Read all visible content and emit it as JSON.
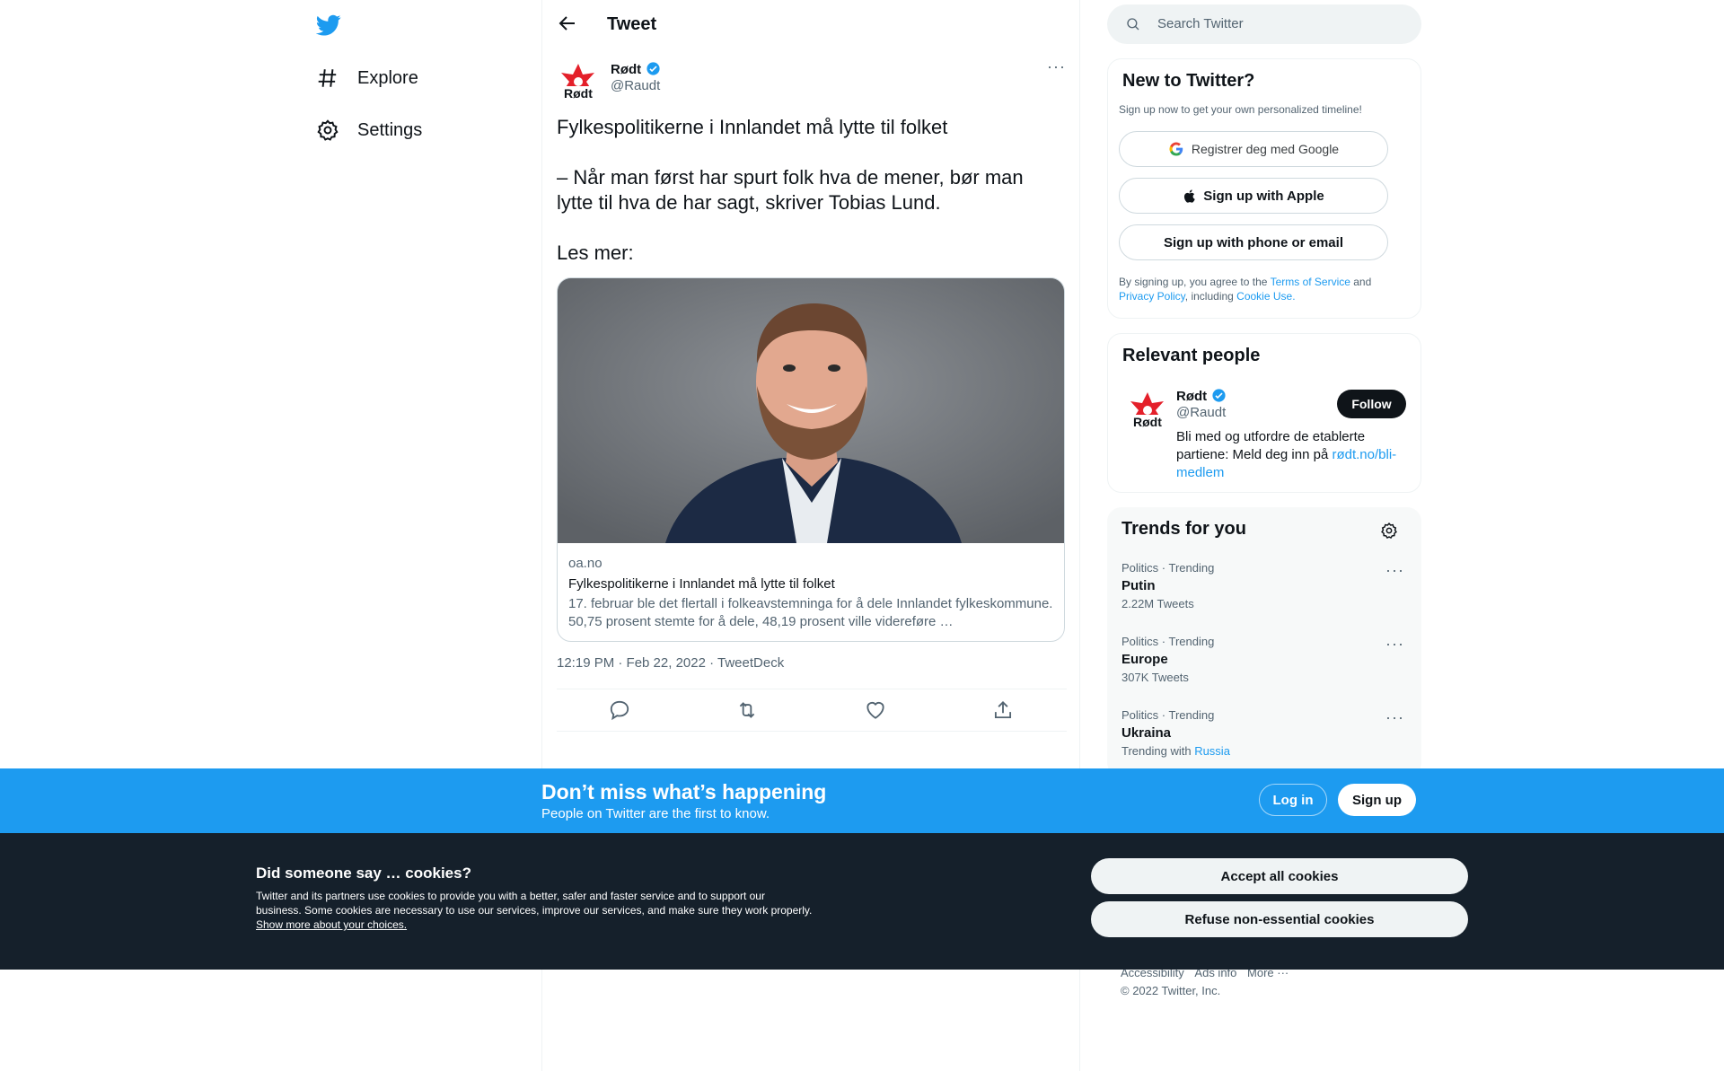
{
  "nav": {
    "explore_label": "Explore",
    "settings_label": "Settings"
  },
  "header": {
    "title": "Tweet"
  },
  "tweet": {
    "author_name": "Rødt",
    "author_handle": "@Raudt",
    "avatar_text": "Rødt",
    "text_line1": "Fylkespolitikerne i Innlandet må lytte til folket",
    "text_line2": "– Når man først har spurt folk hva de mener, bør man lytte til hva de har sagt, skriver Tobias Lund.",
    "text_line3": "Les mer:",
    "card": {
      "domain": "oa.no",
      "title": "Fylkespolitikerne i Innlandet må lytte til folket",
      "description": "17. februar ble det flertall i folkeavstemninga for å dele Innlandet fylkeskommune. 50,75 prosent stemte for å dele, 48,19 prosent ville videreføre …"
    },
    "timestamp": "12:19 PM · Feb 22, 2022 · TweetDeck"
  },
  "search": {
    "placeholder": "Search Twitter"
  },
  "signup_panel": {
    "title": "New to Twitter?",
    "subtitle": "Sign up now to get your own personalized timeline!",
    "google_label": "Registrer deg med Google",
    "apple_label": "Sign up with Apple",
    "phone_label": "Sign up with phone or email",
    "legal_prefix": "By signing up, you agree to the ",
    "terms_link": "Terms of Service",
    "legal_and": " and",
    "privacy_link": "Privacy Policy",
    "legal_including": ", including ",
    "cookie_link": "Cookie Use."
  },
  "relevant_people": {
    "title": "Relevant people",
    "name": "Rødt",
    "handle": "@Raudt",
    "follow_label": "Follow",
    "bio_text": "Bli med og utfordre de etablerte partiene: Meld deg inn på ",
    "bio_link": "rødt.no/bli-medlem"
  },
  "trends": {
    "title": "Trends for you",
    "items": [
      {
        "category": "Politics · Trending",
        "name": "Putin",
        "count": "2.22M Tweets"
      },
      {
        "category": "Politics · Trending",
        "name": "Europe",
        "count": "307K Tweets"
      },
      {
        "category": "Politics · Trending",
        "name": "Ukraina",
        "trending_with_label": "Trending with",
        "trending_with_link": "Russia"
      }
    ]
  },
  "banner": {
    "title": "Don’t miss what’s happening",
    "subtitle": "People on Twitter are the first to know.",
    "login_label": "Log in",
    "signup_label": "Sign up"
  },
  "cookies": {
    "title": "Did someone say … cookies?",
    "text": "Twitter and its partners use cookies to provide you with a better, safer and faster service and to support our business. Some cookies are necessary to use our services, improve our services, and make sure they work properly. ",
    "link": "Show more about your choices.",
    "accept_label": "Accept all cookies",
    "refuse_label": "Refuse non-essential cookies"
  },
  "footer": {
    "accessibility": "Accessibility",
    "ads_info": "Ads info",
    "more": "More ···",
    "copyright": "© 2022 Twitter, Inc."
  },
  "colors": {
    "twitter_blue": "#1d9bf0",
    "rodt_red": "#e4202a",
    "cookie_bg": "#15202b"
  }
}
